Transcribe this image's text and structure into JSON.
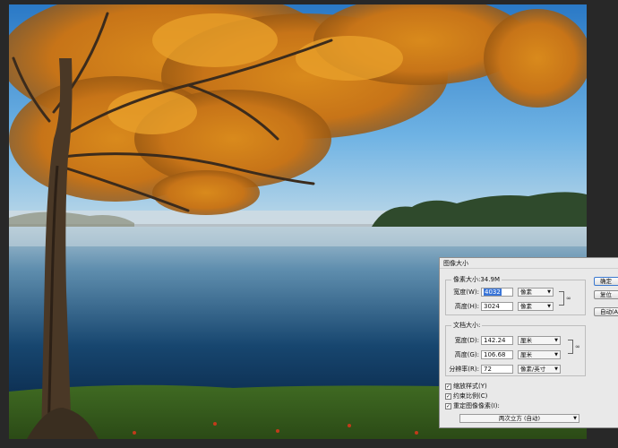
{
  "dialog": {
    "title": "图像大小",
    "check_mark": "✓",
    "pixel_dimensions": {
      "legend": "像素大小:34.9M",
      "width_label": "宽度(W):",
      "width_value": "4032",
      "width_unit": "像素",
      "height_label": "高度(H):",
      "height_value": "3024",
      "height_unit": "像素"
    },
    "document_size": {
      "legend": "文档大小:",
      "width_label": "宽度(D):",
      "width_value": "142.24",
      "width_unit": "厘米",
      "height_label": "高度(G):",
      "height_value": "106.68",
      "height_unit": "厘米",
      "resolution_label": "分辨率(R):",
      "resolution_value": "72",
      "resolution_unit": "像素/英寸"
    },
    "options": {
      "scale_styles": "缩放样式(Y)",
      "constrain_proportions": "约束比例(C)",
      "resample_image": "重定图像像素(I):",
      "resample_method": "两次立方 (自动)"
    },
    "buttons": {
      "ok": "确定",
      "reset": "复位",
      "auto": "自动(A)..."
    }
  }
}
